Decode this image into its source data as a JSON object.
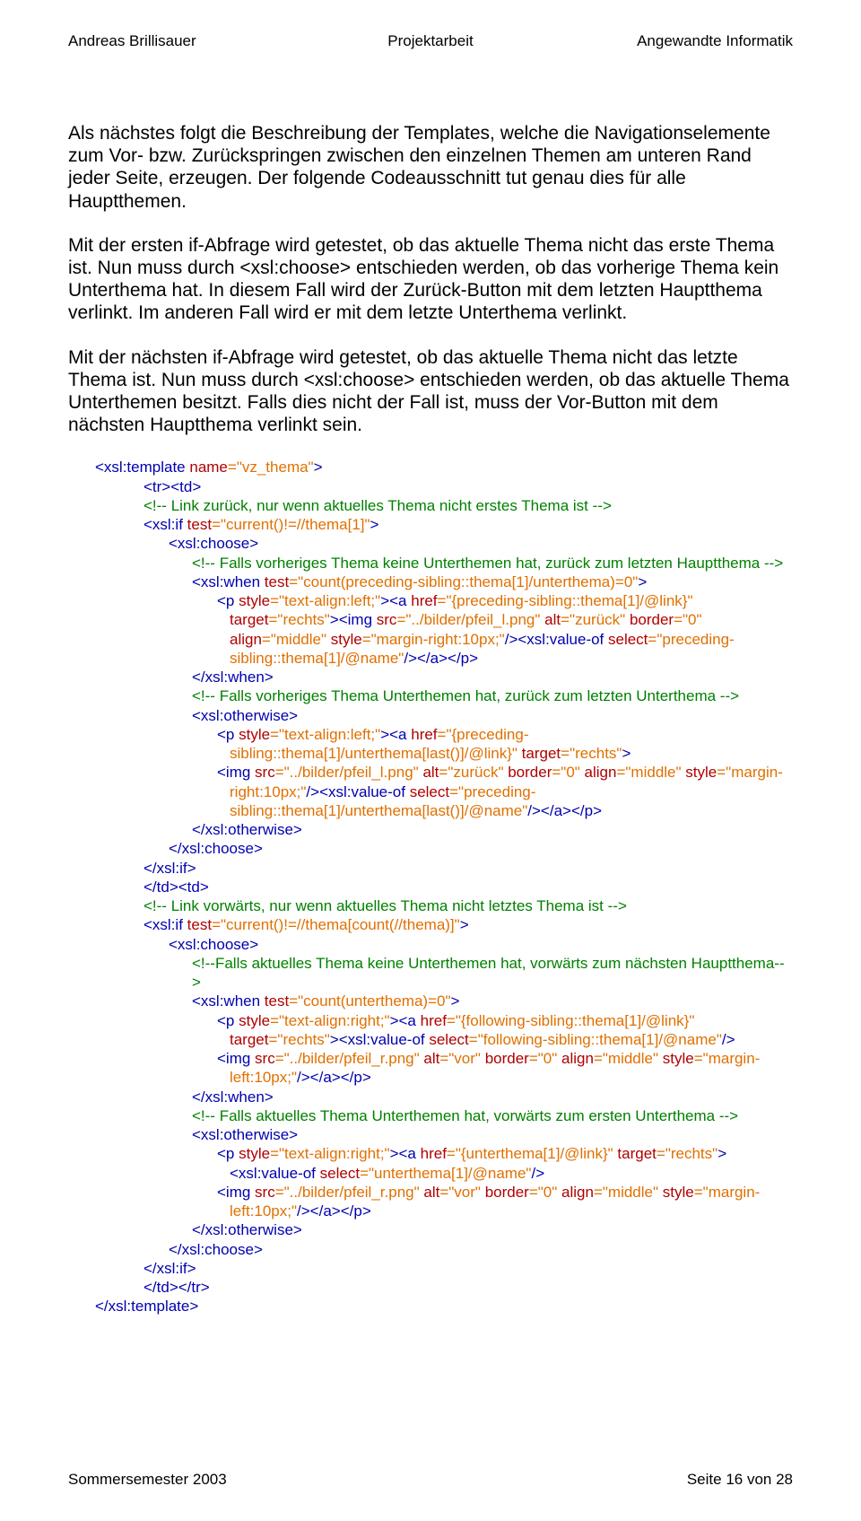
{
  "header": {
    "left": "Andreas Brillisauer",
    "center": "Projektarbeit",
    "right": "Angewandte Informatik"
  },
  "para1": "Als nächstes folgt die Beschreibung der Templates, welche die Navigationselemente zum Vor- bzw. Zurückspringen zwischen den einzelnen Themen am unteren Rand jeder Seite, erzeugen. Der folgende Codeausschnitt tut genau dies für alle Hauptthemen.",
  "para2": "Mit der ersten if-Abfrage wird getestet, ob das aktuelle Thema nicht das erste Thema ist. Nun muss durch <xsl:choose> entschieden werden, ob das vorherige Thema kein Unterthema hat. In diesem Fall wird der Zurück-Button mit dem letzten Hauptthema verlinkt. Im anderen Fall wird er mit dem letzte Unterthema verlinkt.",
  "para3": "Mit der nächsten if-Abfrage wird getestet, ob das aktuelle Thema nicht das letzte Thema ist. Nun muss durch <xsl:choose> entschieden werden, ob das aktuelle Thema Unterthemen besitzt. Falls dies nicht der Fall ist, muss der Vor-Button mit dem nächsten Hauptthema verlinkt sein.",
  "code": {
    "l00": {
      "tag": "<xsl:template ",
      "attr": "name",
      "val": "=\"vz_thema\"",
      "tag2": ">"
    },
    "l01": "<tr><td>",
    "l02c": "<!-- Link zurück, nur wenn aktuelles Thema nicht erstes Thema ist -->",
    "l03": {
      "tag": "<xsl:if ",
      "attr": "test",
      "val": "=\"current()!=//thema[1]\"",
      "tag2": ">"
    },
    "l04": "<xsl:choose>",
    "l05c": "<!-- Falls vorheriges Thema keine Unterthemen hat, zurück zum letzten Hauptthema -->",
    "l06": {
      "tag": "<xsl:when ",
      "attr": "test",
      "val": "=\"count(preceding-sibling::thema[1]/unterthema)=0\"",
      "tag2": ">"
    },
    "l07": {
      "tag": "<p ",
      "attr": "style",
      "val": "=\"text-align:left;\"",
      "tag2": "><a ",
      "attr2": "href",
      "val2": "=\"{preceding-sibling::thema[1]/@link}\""
    },
    "l08": {
      "attr": "target",
      "val": "=\"rechts\"",
      "tag": "><img ",
      "attr2": "src",
      "val2": "=\"../bilder/pfeil_l.png\"",
      "sp": " ",
      "attr3": "alt",
      "val3": "=\"zurück\"",
      "sp2": " ",
      "attr4": "border",
      "val4": "=\"0\""
    },
    "l09": {
      "attr": "align",
      "val": "=\"middle\"",
      "sp": " ",
      "attr2": "style",
      "val2": "=\"margin-right:10px;\"",
      "tag": "/><xsl:value-of ",
      "attr3": "select",
      "val3": "=\"preceding-sibling::thema[1]/@name\"",
      "tag2": "/></a></p>"
    },
    "l10": "</xsl:when>",
    "l11c": "<!-- Falls vorheriges Thema Unterthemen hat, zurück zum letzten Unterthema -->",
    "l12": "<xsl:otherwise>",
    "l13": {
      "tag": "<p ",
      "attr": "style",
      "val": "=\"text-align:left;\"",
      "tag2": "><a ",
      "attr2": "href",
      "val2": "=\"{preceding-sibling::thema[1]/unterthema[last()]/@link}\"",
      "sp": " ",
      "attr3": "target",
      "val3": "=\"rechts\"",
      "tag3": ">"
    },
    "l14": {
      "tag": "<img ",
      "attr": "src",
      "val": "=\"../bilder/pfeil_l.png\"",
      "sp": " ",
      "attr2": "alt",
      "val2": "=\"zurück\"",
      "sp2": " ",
      "attr3": "border",
      "val3": "=\"0\"",
      "sp3": " ",
      "attr4": "align",
      "val4": "=\"middle\""
    },
    "l15": {
      "attr": "style",
      "val": "=\"margin-right:10px;\"",
      "tag": "/><xsl:value-of ",
      "attr2": "select",
      "val2": "=\"preceding-sibling::thema[1]/unterthema[last()]/@name\"",
      "tag2": "/></a></p>"
    },
    "l16": "</xsl:otherwise>",
    "l17": "</xsl:choose>",
    "l18": "</xsl:if>",
    "l19": "</td><td>",
    "l20c": "<!-- Link vorwärts, nur wenn aktuelles Thema nicht letztes Thema ist -->",
    "l21": {
      "tag": "<xsl:if ",
      "attr": "test",
      "val": "=\"current()!=//thema[count(//thema)]\"",
      "tag2": ">"
    },
    "l22": "<xsl:choose>",
    "l23c": "<!--Falls aktuelles Thema keine Unterthemen hat, vorwärts zum nächsten Hauptthema-->",
    "l24": {
      "tag": "<xsl:when ",
      "attr": "test",
      "val": "=\"count(unterthema)=0\"",
      "tag2": ">"
    },
    "l25": {
      "tag": "<p ",
      "attr": "style",
      "val": "=\"text-align:right;\"",
      "tag2": "><a ",
      "attr2": "href",
      "val2": "=\"{following-sibling::thema[1]/@link}\""
    },
    "l26": {
      "attr": "target",
      "val": "=\"rechts\"",
      "tag": "><xsl:value-of ",
      "attr2": "select",
      "val2": "=\"following-sibling::thema[1]/@name\"",
      "tag2": "/>"
    },
    "l27": {
      "tag": "<img ",
      "attr": "src",
      "val": "=\"../bilder/pfeil_r.png\"",
      "sp": " ",
      "attr2": "alt",
      "val2": "=\"vor\"",
      "sp2": " ",
      "attr3": "border",
      "val3": "=\"0\"",
      "sp3": " ",
      "attr4": "align",
      "val4": "=\"middle\"",
      "sp4": " ",
      "attr5": "style",
      "val5": "=\"margin-left:10px;\"",
      "tag2": "/></a></p>"
    },
    "l28": "</xsl:when>",
    "l29c": "<!-- Falls aktuelles Thema Unterthemen hat, vorwärts zum ersten Unterthema -->",
    "l30": "<xsl:otherwise>",
    "l31": {
      "tag": "<p ",
      "attr": "style",
      "val": "=\"text-align:right;\"",
      "tag2": "><a ",
      "attr2": "href",
      "val2": "=\"{unterthema[1]/@link}\""
    },
    "l32": {
      "attr": "target",
      "val": "=\"rechts\"",
      "tag": "><xsl:value-of ",
      "attr2": "select",
      "val2": "=\"unterthema[1]/@name\"",
      "tag2": "/>"
    },
    "l33": {
      "tag": "<img ",
      "attr": "src",
      "val": "=\"../bilder/pfeil_r.png\"",
      "sp": " ",
      "attr2": "alt",
      "val2": "=\"vor\"",
      "sp2": " ",
      "attr3": "border",
      "val3": "=\"0\""
    },
    "l34": {
      "attr": "align",
      "val": "=\"middle\"",
      "sp": " ",
      "attr2": "style",
      "val2": "=\"margin-left:10px;\"",
      "tag": "/></a></p>"
    },
    "l35": "</xsl:otherwise>",
    "l36": "</xsl:choose>",
    "l37": "</xsl:if>",
    "l38": "</td></tr>",
    "l39": "</xsl:template>"
  },
  "footer": {
    "left": "Sommersemester 2003",
    "right": "Seite 16 von 28"
  }
}
